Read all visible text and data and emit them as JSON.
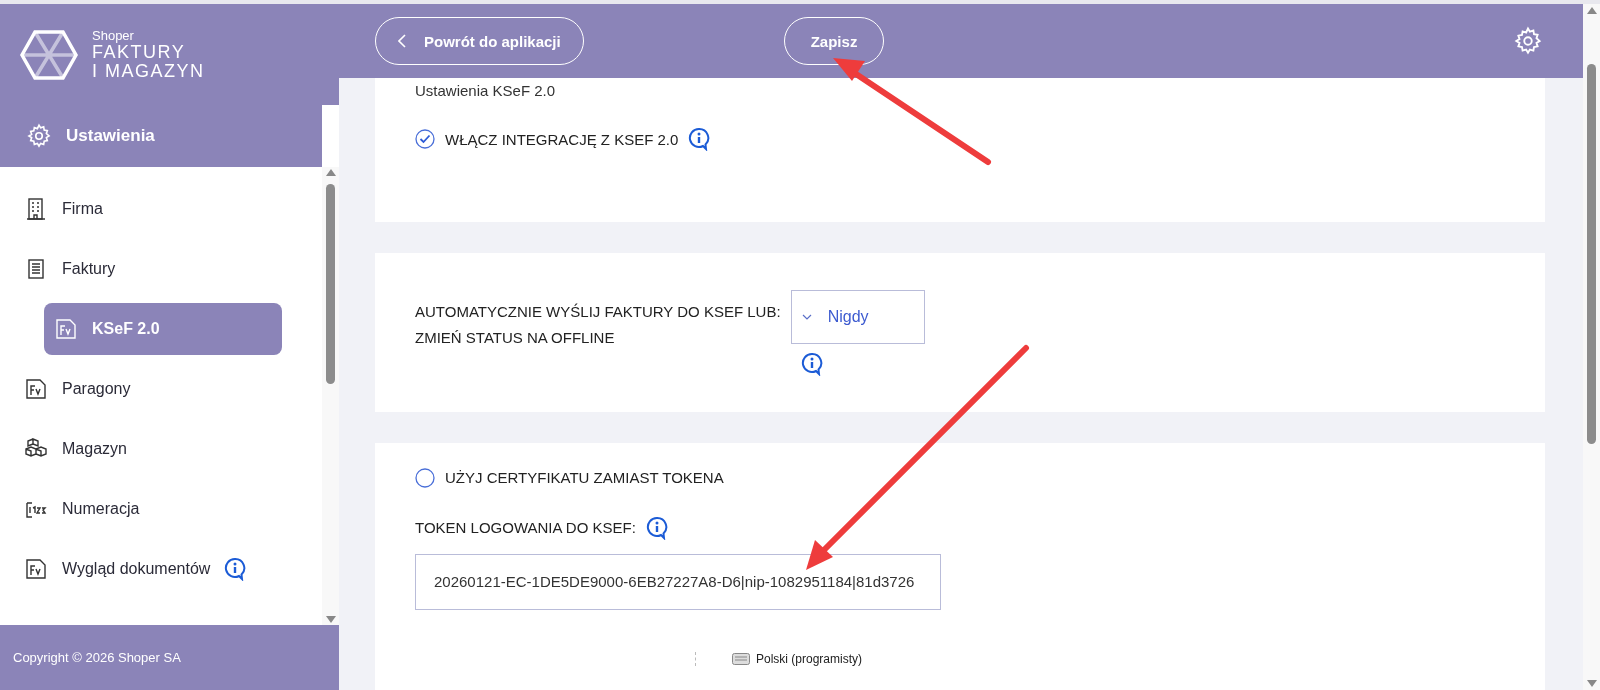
{
  "sidebar": {
    "logo": {
      "brand": "Shoper",
      "line1": "FAKTURY",
      "line2": "I MAGAZYN"
    },
    "section": {
      "label": "Ustawienia"
    },
    "items": [
      {
        "label": "Firma",
        "kind": "building",
        "selected": false,
        "info": false
      },
      {
        "label": "Faktury",
        "kind": "list",
        "selected": false,
        "info": false,
        "children": [
          {
            "label": "KSeF 2.0",
            "kind": "fv",
            "selected": true,
            "info": false
          }
        ]
      },
      {
        "label": "Paragony",
        "kind": "fv",
        "selected": false,
        "info": false
      },
      {
        "label": "Magazyn",
        "kind": "boxes",
        "selected": false,
        "info": false
      },
      {
        "label": "Numeracja",
        "kind": "numbers",
        "selected": false,
        "info": false
      },
      {
        "label": "Wygląd dokumentów",
        "kind": "fv",
        "selected": false,
        "info": true
      }
    ],
    "footer": "Copyright © 2026 Shoper SA"
  },
  "header": {
    "back_button": "Powrót do aplikacji",
    "save_button": "Zapisz"
  },
  "cards": [
    {
      "heading": "Ustawienia KSeF 2.0",
      "fields": [
        {
          "kind": "checkbox",
          "label": "WŁĄCZ INTEGRACJĘ Z KSEF 2.0",
          "checked": true,
          "info": true
        }
      ]
    },
    {
      "fields": [
        {
          "kind": "select",
          "label_lines": [
            "AUTOMATYCZNIE WYŚLIJ FAKTURY DO KSEF LUB:",
            "ZMIEŃ STATUS NA OFFLINE"
          ],
          "value": "Nigdy",
          "info": true
        }
      ]
    },
    {
      "fields": [
        {
          "kind": "radio",
          "label": "UŻYJ CERTYFIKATU ZAMIAST TOKENA",
          "selected": false,
          "info": false
        },
        {
          "kind": "text",
          "label": "TOKEN LOGOWANIA DO KSEF:",
          "value": "20260121-EC-1DE5DE9000-6EB27227A8-D6|nip-1082951184|81d3726",
          "info": true
        }
      ]
    }
  ],
  "language_bar": {
    "label": "Polski (programisty)"
  }
}
